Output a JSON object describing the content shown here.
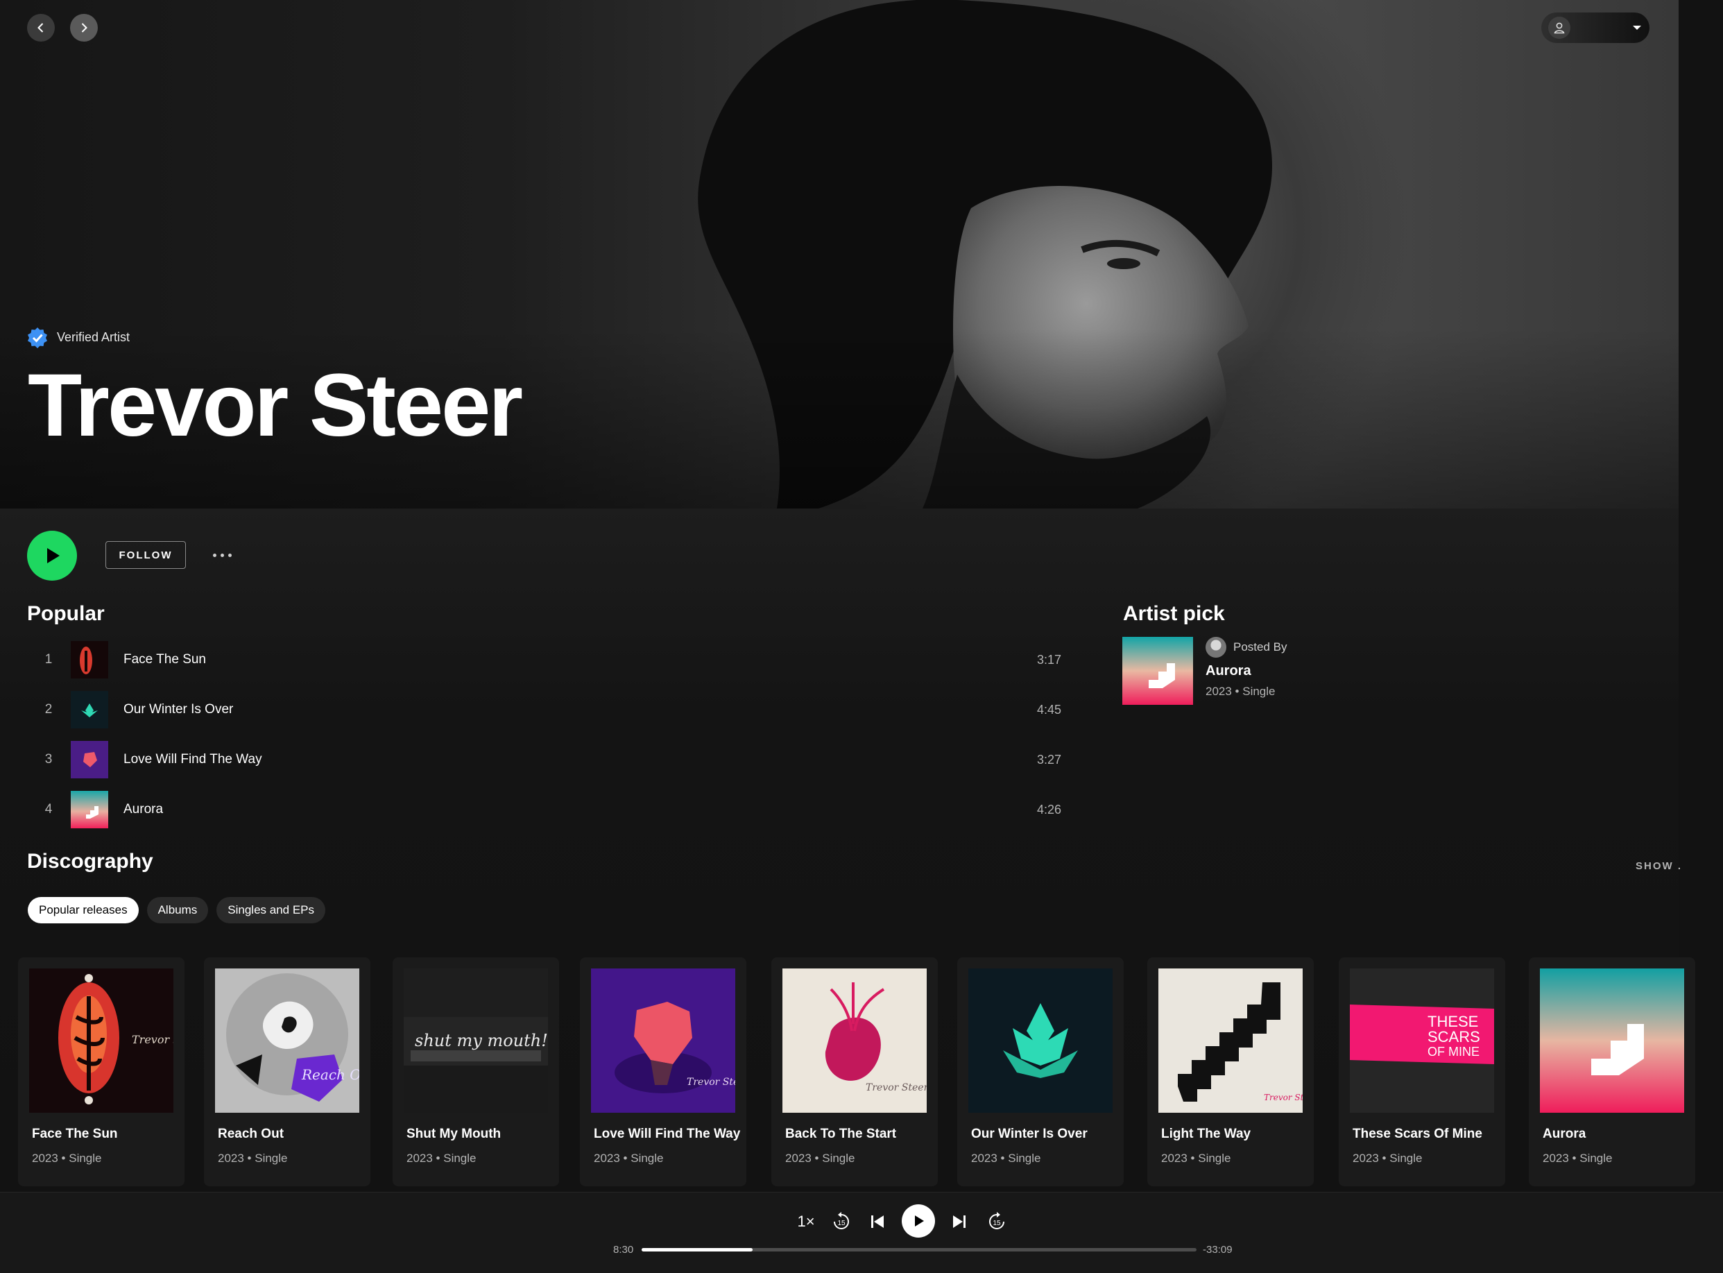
{
  "header": {
    "back_icon": "chevron-left-icon",
    "forward_icon": "chevron-right-icon",
    "user_name": ""
  },
  "artist": {
    "verified_label": "Verified Artist",
    "name": "Trevor Steer"
  },
  "actions": {
    "follow_label": "FOLLOW"
  },
  "popular": {
    "title": "Popular",
    "tracks": [
      {
        "num": "1",
        "title": "Face The Sun",
        "duration": "3:17"
      },
      {
        "num": "2",
        "title": "Our Winter Is Over",
        "duration": "4:45"
      },
      {
        "num": "3",
        "title": "Love Will Find The Way",
        "duration": "3:27"
      },
      {
        "num": "4",
        "title": "Aurora",
        "duration": "4:26"
      }
    ]
  },
  "artist_pick": {
    "title": "Artist pick",
    "posted_by": "Posted By",
    "release": "Aurora",
    "year": "2023",
    "type": "Single"
  },
  "discography": {
    "title": "Discography",
    "show_all": "SHOW .",
    "chips": [
      "Popular releases",
      "Albums",
      "Singles and EPs"
    ],
    "active_chip": "Popular releases",
    "releases": [
      {
        "title": "Face The Sun",
        "year": "2023",
        "type": "Single"
      },
      {
        "title": "Reach Out",
        "year": "2023",
        "type": "Single"
      },
      {
        "title": "Shut My Mouth",
        "year": "2023",
        "type": "Single"
      },
      {
        "title": "Love Will Find The Way",
        "year": "2023",
        "type": "Single"
      },
      {
        "title": "Back To The Start",
        "year": "2023",
        "type": "Single"
      },
      {
        "title": "Our Winter Is Over",
        "year": "2023",
        "type": "Single"
      },
      {
        "title": "Light The Way",
        "year": "2023",
        "type": "Single"
      },
      {
        "title": "These Scars Of Mine",
        "year": "2023",
        "type": "Single"
      },
      {
        "title": "Aurora",
        "year": "2023",
        "type": "Single"
      }
    ]
  },
  "cover_text": {
    "signature": "Trevor Steer",
    "reach_out": "Reach Out",
    "shut_my_mouth": "shut my mouth!..",
    "scars": [
      "THESE",
      "SCARS",
      "OF MINE"
    ]
  },
  "player": {
    "speed": "1×",
    "skip_back_seconds": "15",
    "skip_forward_seconds": "15",
    "elapsed": "8:30",
    "remaining": "-33:09",
    "progress": 0.2
  },
  "colors": {
    "accent": "#1ed760",
    "verified": "#3d91f4",
    "background": "#121212"
  }
}
